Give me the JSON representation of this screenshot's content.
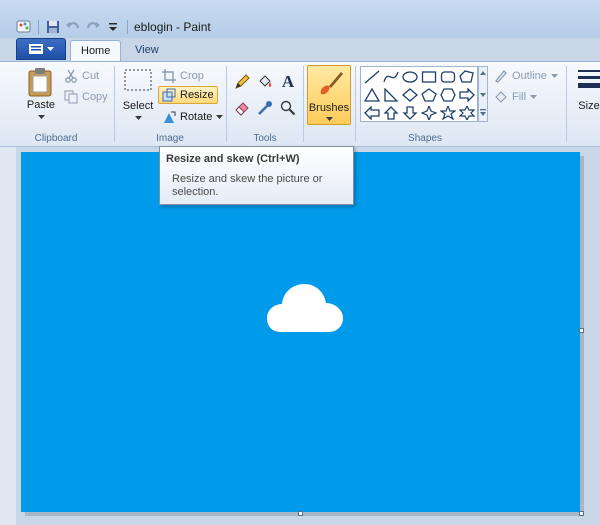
{
  "window": {
    "title": "eblogin - Paint"
  },
  "quick_access": {
    "icons": [
      "paint-app-icon",
      "save-icon",
      "undo-icon",
      "redo-icon",
      "customize-dropdown-icon"
    ]
  },
  "tabs": {
    "home": "Home",
    "view": "View"
  },
  "clipboard": {
    "paste": "Paste",
    "cut": "Cut",
    "copy": "Copy",
    "group": "Clipboard"
  },
  "image": {
    "select": "Select",
    "crop": "Crop",
    "resize": "Resize",
    "rotate": "Rotate",
    "group": "Image"
  },
  "tools": {
    "group": "Tools",
    "text_glyph": "A"
  },
  "brushes": {
    "label": "Brushes"
  },
  "shapes": {
    "outline": "Outline",
    "fill": "Fill",
    "group": "Shapes"
  },
  "size": {
    "label": "Size"
  },
  "tooltip": {
    "title": "Resize and skew (Ctrl+W)",
    "body_line1": "Resize and skew the picture or",
    "body_line2": "selection."
  },
  "colors": {
    "canvas_background": "#009aeb",
    "cloud": "#ffffff",
    "accent_hot": "#ffd97a"
  }
}
